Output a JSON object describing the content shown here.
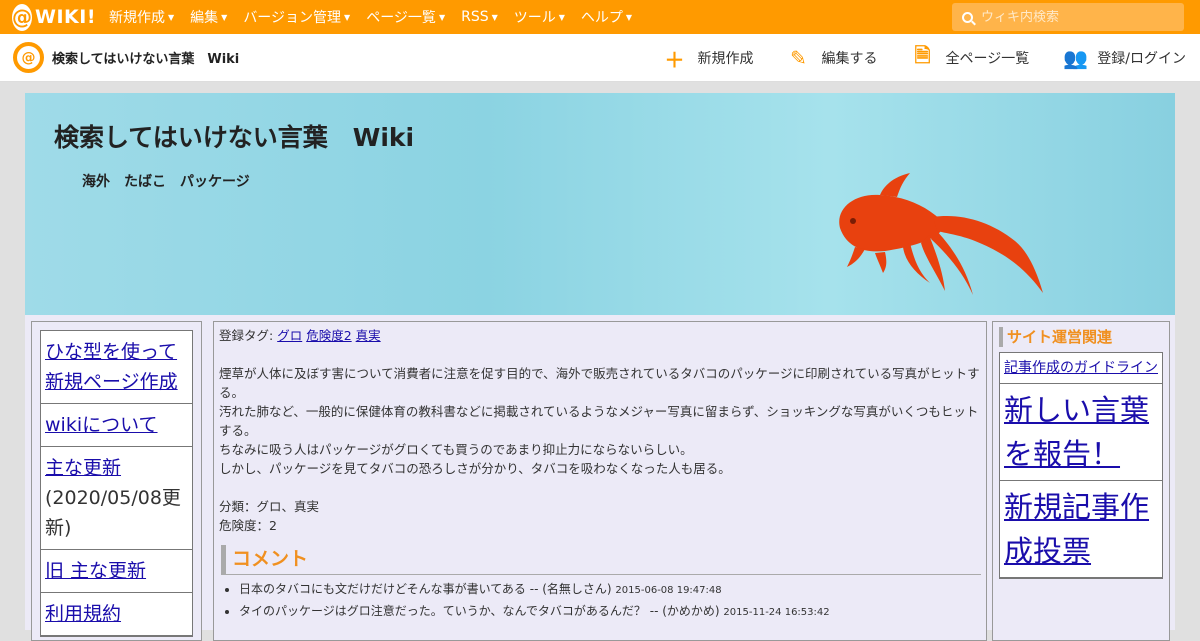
{
  "topbar": {
    "logo_text": "WIKI!",
    "nav": [
      {
        "label": "新規作成"
      },
      {
        "label": "編集"
      },
      {
        "label": "バージョン管理"
      },
      {
        "label": "ページ一覧"
      },
      {
        "label": "RSS"
      },
      {
        "label": "ツール"
      },
      {
        "label": "ヘルプ"
      }
    ],
    "search_placeholder": "ウィキ内検索"
  },
  "subbar": {
    "site_title": "検索してはいけない言葉　Wiki",
    "actions": [
      {
        "label": "新規作成",
        "icon": "plus-icon"
      },
      {
        "label": "編集する",
        "icon": "pencil-icon"
      },
      {
        "label": "全ページ一覧",
        "icon": "document-icon"
      },
      {
        "label": "登録/ログイン",
        "icon": "add-user-icon"
      }
    ]
  },
  "header": {
    "title": "検索してはいけない言葉　Wiki",
    "tagline": "海外　たばこ　パッケージ"
  },
  "left_menu": {
    "items": [
      {
        "label": "ひな型を使って新規ページ作成",
        "note": ""
      },
      {
        "label": "wikiについて",
        "note": ""
      },
      {
        "label": "主な更新",
        "note": "(2020/05/08更新)"
      },
      {
        "label": "旧 主な更新",
        "note": ""
      },
      {
        "label": "利用規約",
        "note": ""
      }
    ]
  },
  "main": {
    "tags_label": "登録タグ:",
    "tags": [
      "グロ",
      "危険度2",
      "真実"
    ],
    "paragraphs": [
      "煙草が人体に及ぼす害について消費者に注意を促す目的で、海外で販売されているタバコのパッケージに印刷されている写真がヒットする。",
      "汚れた肺など、一般的に保健体育の教科書などに掲載されているようなメジャー写真に留まらず、ショッキングな写真がいくつもヒットする。",
      "ちなみに吸う人はパッケージがグロくても買うのであまり抑止力にならないらしい。",
      "しかし、パッケージを見てタバコの恐ろしさが分かり、タバコを吸わなくなった人も居る。"
    ],
    "category": "分類：グロ、真実",
    "danger": "危険度：2",
    "comment_heading": "コメント",
    "comments": [
      {
        "text": "日本のタバコにも文だけだけどそんな事が書いてある -- (名無しさん)",
        "time": "2015-06-08 19:47:48"
      },
      {
        "text": "タイのパッケージはグロ注意だった。ていうか、なんでタバコがあるんだ？ -- (かめかめ)",
        "time": "2015-11-24 16:53:42"
      }
    ]
  },
  "right_menu": {
    "heading": "サイト運営関連",
    "items": [
      {
        "label": "記事作成のガイドライン",
        "size": "small"
      },
      {
        "label": "新しい言葉を報告！",
        "size": "big"
      },
      {
        "label": "新規記事作成投票",
        "size": "big"
      }
    ]
  },
  "colors": {
    "brand_orange": "#ff9a00",
    "header_blue": "#8bd3e2",
    "goldfish": "#e8410f",
    "link": "#1a0dab"
  }
}
